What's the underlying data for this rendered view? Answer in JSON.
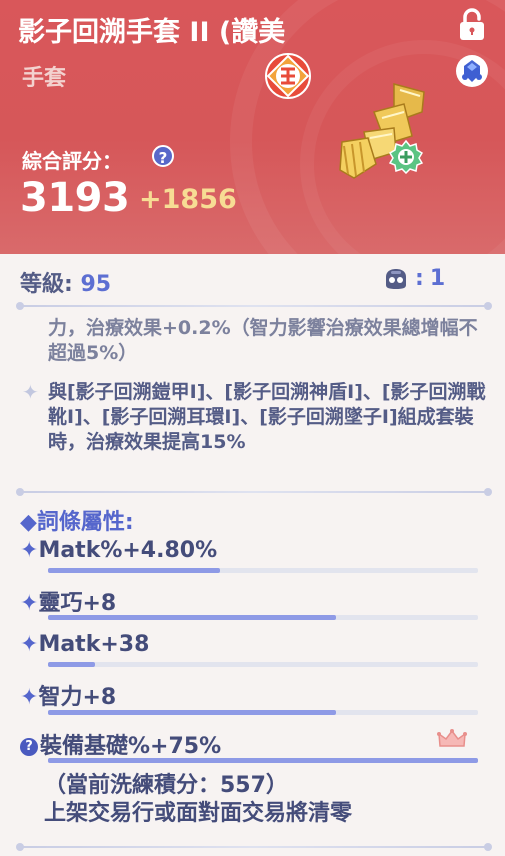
{
  "header": {
    "item_name": "影子回溯手套 II (讚美",
    "item_type": "手套",
    "score_label": "綜合評分：",
    "help_symbol": "?",
    "score": "3193",
    "score_delta": "+1856",
    "colors": {
      "header_bg": "#d9575a",
      "delta": "#f7dc94",
      "help": "#5868c9"
    }
  },
  "info": {
    "level_label": "等級: ",
    "level_value": "95",
    "slot_value": "1"
  },
  "effects": {
    "faded_text": "力，治療效果+0.2%（智力影響治療效果總增幅不超過5%）",
    "set_bonus": "與[影子回溯鎧甲Ⅰ]、[影子回溯神盾Ⅰ]、[影子回溯戰靴Ⅰ]、[影子回溯耳環Ⅰ]、[影子回溯墜子Ⅰ]組成套裝時，治療效果提高15%"
  },
  "attributes": {
    "title": "詞條屬性:",
    "items": [
      {
        "label": "Matk%+4.80%",
        "fill": 0.4
      },
      {
        "label": "靈巧+8",
        "fill": 0.67
      },
      {
        "label": "Matk+38",
        "fill": 0.11
      },
      {
        "label": "智力+8",
        "fill": 0.67
      },
      {
        "label": "裝備基礎%+75%",
        "fill": 1.0
      }
    ],
    "accent_color": "#8e9ae6"
  },
  "refine": {
    "points_line": "（當前洗練積分：557）",
    "warning_line": "上架交易行或面對面交易將清零"
  }
}
